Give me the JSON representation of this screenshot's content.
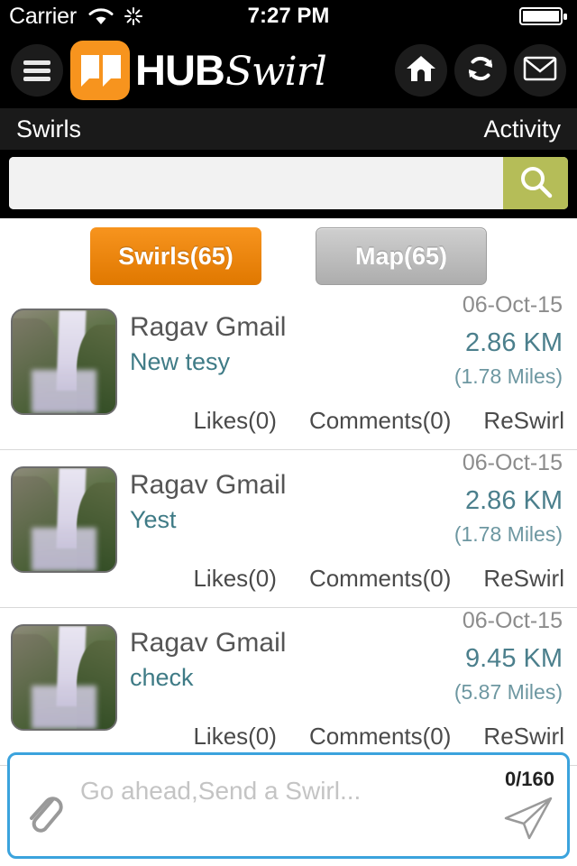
{
  "status_bar": {
    "carrier": "Carrier",
    "time": "7:27 PM",
    "wifi_icon": "wifi-icon",
    "activity_icon": "activity-spinner-icon",
    "battery_icon": "battery-full-icon"
  },
  "header": {
    "menu_icon": "hamburger-menu-icon",
    "logo_mark_icon": "speech-bubbles-logo-icon",
    "logo_primary": "HUB",
    "logo_secondary": "Swirl",
    "home_icon": "home-icon",
    "refresh_icon": "refresh-sync-icon",
    "mail_icon": "envelope-icon"
  },
  "subnav": {
    "left_label": "Swirls",
    "right_label": "Activity"
  },
  "search": {
    "value": "",
    "placeholder": "",
    "button_icon": "search-icon",
    "button_color": "#b5bd58"
  },
  "tabs": [
    {
      "label": "Swirls(65)",
      "active": true,
      "color": "#f7941e"
    },
    {
      "label": "Map(65)",
      "active": false,
      "color": "#bdbdbd"
    }
  ],
  "action_labels": {
    "likes": "Likes(0)",
    "comments": "Comments(0)",
    "reswirl": "ReSwirl"
  },
  "swirls": [
    {
      "name": "Ragav Gmail",
      "message": "New tesy",
      "date": "06-Oct-15",
      "distance_km": "2.86 KM",
      "distance_miles": "(1.78 Miles)",
      "likes": "Likes(0)",
      "comments": "Comments(0)",
      "reswirl": "ReSwirl",
      "thumbnail": "waterfall-photo"
    },
    {
      "name": "Ragav Gmail",
      "message": "Yest",
      "date": "06-Oct-15",
      "distance_km": "2.86 KM",
      "distance_miles": "(1.78 Miles)",
      "likes": "Likes(0)",
      "comments": "Comments(0)",
      "reswirl": "ReSwirl",
      "thumbnail": "waterfall-photo"
    },
    {
      "name": "Ragav Gmail",
      "message": "check",
      "date": "06-Oct-15",
      "distance_km": "9.45 KM",
      "distance_miles": "(5.87 Miles)",
      "likes": "Likes(0)",
      "comments": "Comments(0)",
      "reswirl": "ReSwirl",
      "thumbnail": "waterfall-photo"
    }
  ],
  "compose": {
    "placeholder": "Go ahead,Send a Swirl...",
    "value": "",
    "counter": "0/160",
    "attach_icon": "paperclip-icon",
    "send_icon": "send-paper-plane-icon",
    "border_color": "#3ba3dd"
  }
}
